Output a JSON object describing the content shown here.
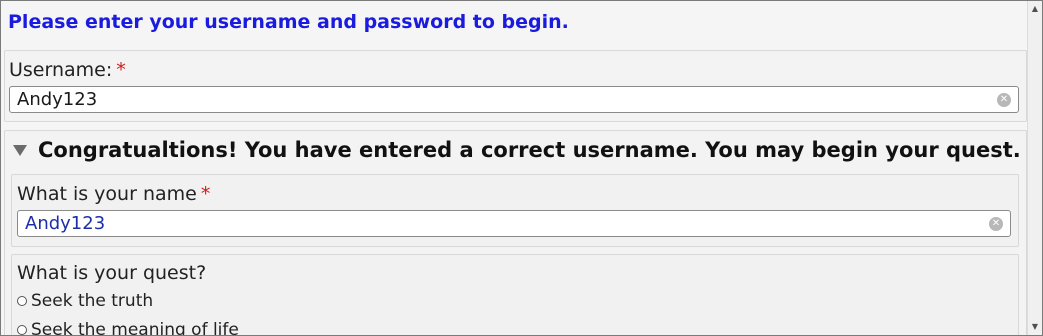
{
  "header": {
    "text": "Please enter your username and password to begin."
  },
  "username": {
    "label": "Username:",
    "required_mark": "*",
    "value": "Andy123"
  },
  "quest_section": {
    "title": "Congratualtions! You have entered a correct username. You may begin your quest.",
    "name_field": {
      "label": "What is your name",
      "required_mark": "*",
      "value": "Andy123"
    },
    "quest_question": {
      "label": "What is your quest?",
      "options": [
        "Seek the truth",
        "Seek the meaning of life"
      ]
    }
  },
  "colors": {
    "header": "#1b1be0",
    "required": "#d11a1a",
    "name_value": "#1c2fa8"
  },
  "icons": {
    "clear": "clear-circle-icon",
    "disclosure": "triangle-down-icon"
  }
}
